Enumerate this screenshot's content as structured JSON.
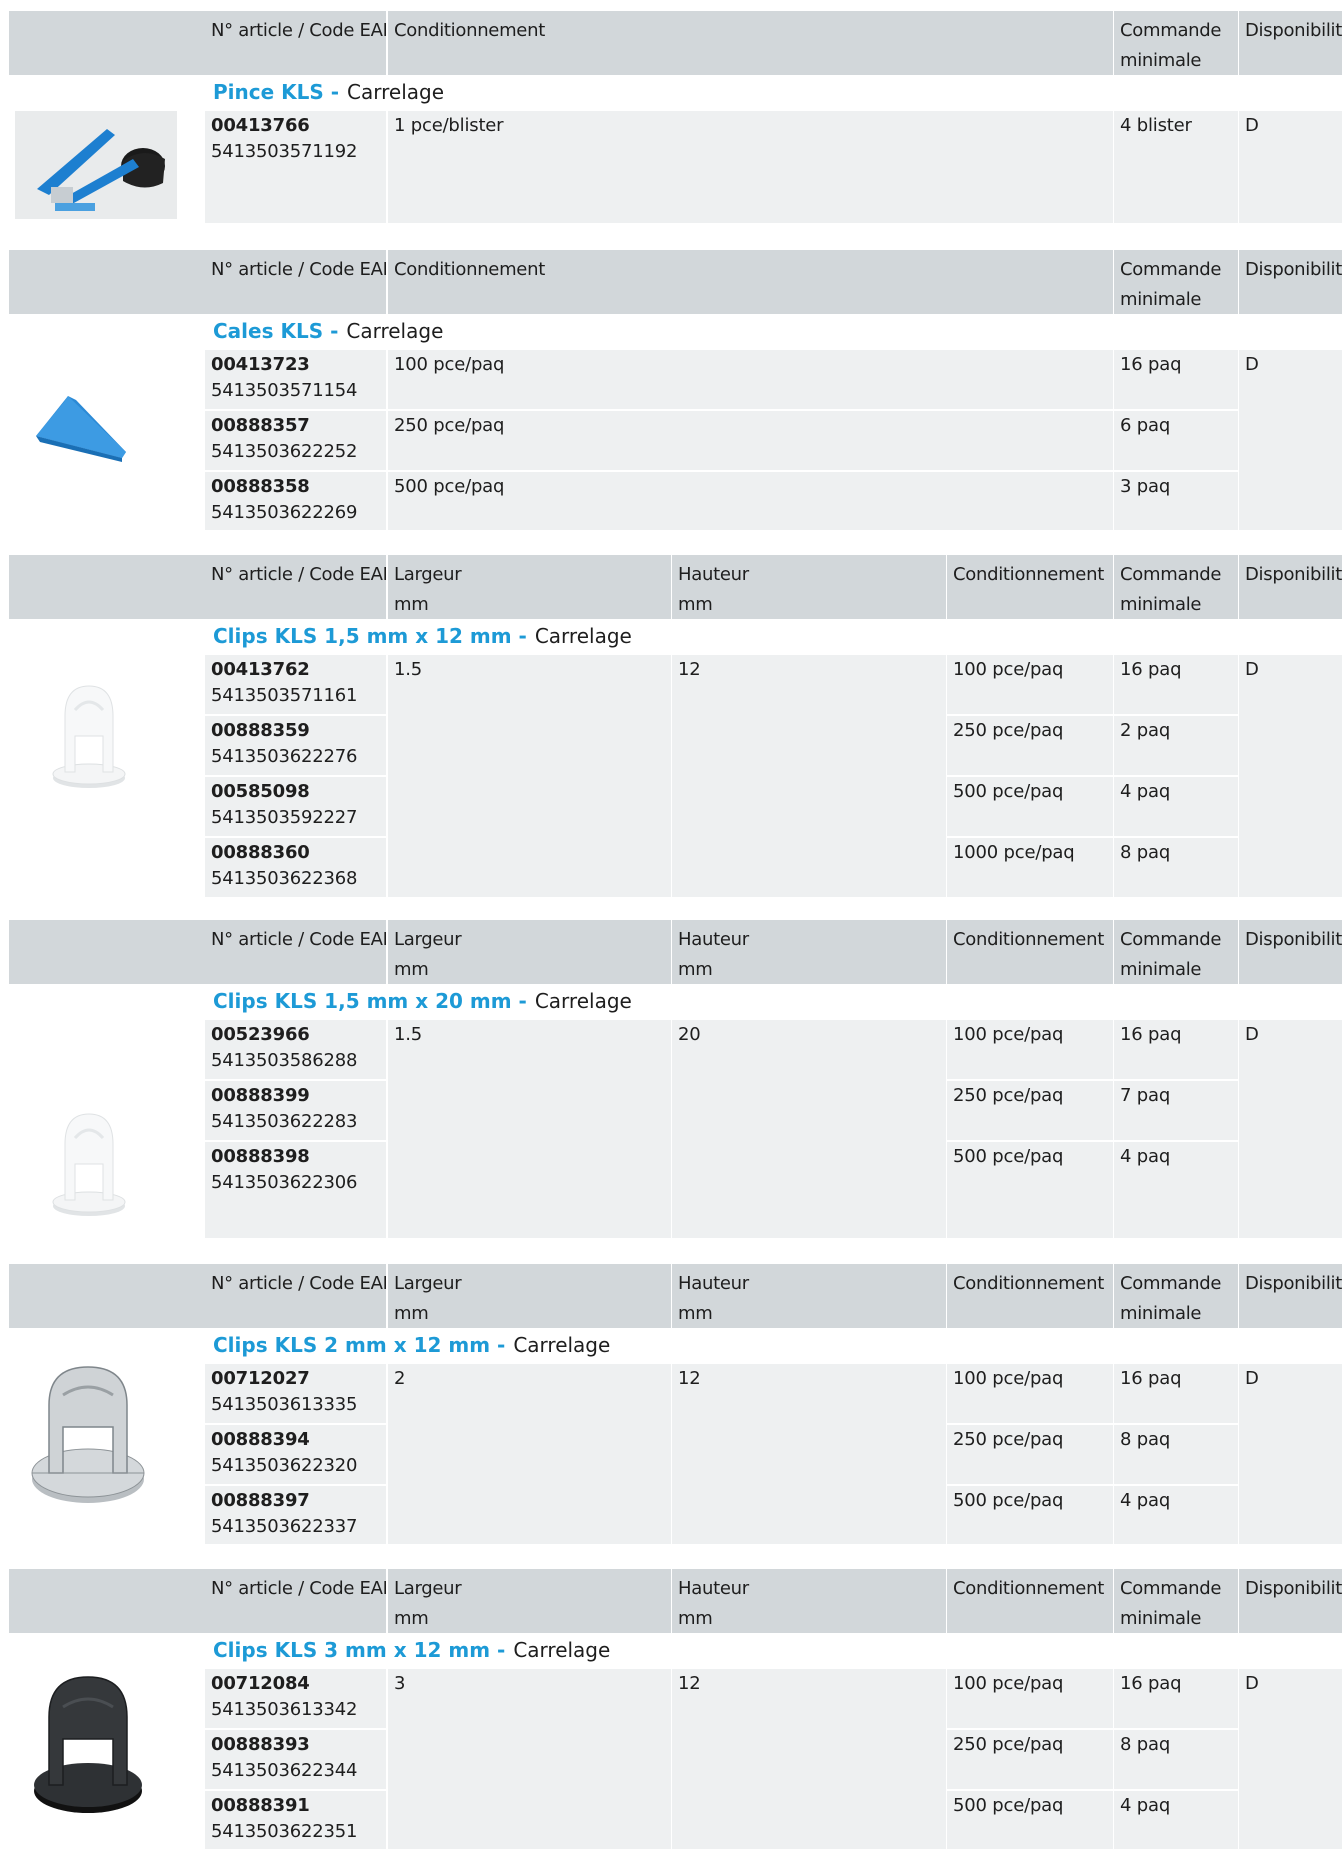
{
  "headers": {
    "simple": [
      "N° article / Code EAN",
      "Conditionnement",
      "Commande\nminimale",
      "Disponibilité"
    ],
    "dims": [
      "N° article / Code EAN",
      "Largeur\nmm",
      "Hauteur\nmm",
      "Conditionnement",
      "Commande\nminimale",
      "Disponibilité"
    ]
  },
  "sections": [
    {
      "title": "Pince KLS -",
      "category": "Carrelage",
      "image_icon": "tile-leveling-pliers-icon",
      "availability": "D",
      "rows": [
        {
          "code": "00413766",
          "ean": "5413503571192",
          "packaging": "1 pce/blister",
          "min_order": "4 blister"
        }
      ]
    },
    {
      "title": "Cales KLS -",
      "category": "Carrelage",
      "image_icon": "blue-wedge-icon",
      "availability": "D",
      "rows": [
        {
          "code": "00413723",
          "ean": "5413503571154",
          "packaging": "100 pce/paq",
          "min_order": "16 paq"
        },
        {
          "code": "00888357",
          "ean": "5413503622252",
          "packaging": "250 pce/paq",
          "min_order": "6 paq"
        },
        {
          "code": "00888358",
          "ean": "5413503622269",
          "packaging": "500 pce/paq",
          "min_order": "3 paq"
        }
      ]
    },
    {
      "title": "Clips KLS 1,5 mm x 12 mm -",
      "category": "Carrelage",
      "image_icon": "white-clip-icon",
      "width": "1.5",
      "height": "12",
      "availability": "D",
      "rows": [
        {
          "code": "00413762",
          "ean": "5413503571161",
          "packaging": "100 pce/paq",
          "min_order": "16 paq"
        },
        {
          "code": "00888359",
          "ean": "5413503622276",
          "packaging": "250 pce/paq",
          "min_order": "2 paq"
        },
        {
          "code": "00585098",
          "ean": "5413503592227",
          "packaging": "500 pce/paq",
          "min_order": "4 paq"
        },
        {
          "code": "00888360",
          "ean": "5413503622368",
          "packaging": "1000 pce/paq",
          "min_order": "8 paq"
        }
      ]
    },
    {
      "title": "Clips KLS 1,5 mm x 20 mm -",
      "category": "Carrelage",
      "image_icon": "white-clip-icon",
      "width": "1.5",
      "height": "20",
      "availability": "D",
      "rows": [
        {
          "code": "00523966",
          "ean": "5413503586288",
          "packaging": "100 pce/paq",
          "min_order": "16 paq"
        },
        {
          "code": "00888399",
          "ean": "5413503622283",
          "packaging": "250 pce/paq",
          "min_order": "7 paq"
        },
        {
          "code": "00888398",
          "ean": "5413503622306",
          "packaging": "500 pce/paq",
          "min_order": "4 paq"
        }
      ]
    },
    {
      "title": "Clips KLS 2 mm x 12 mm -",
      "category": "Carrelage",
      "image_icon": "grey-clip-icon",
      "width": "2",
      "height": "12",
      "availability": "D",
      "rows": [
        {
          "code": "00712027",
          "ean": "5413503613335",
          "packaging": "100 pce/paq",
          "min_order": "16 paq"
        },
        {
          "code": "00888394",
          "ean": "5413503622320",
          "packaging": "250 pce/paq",
          "min_order": "8 paq"
        },
        {
          "code": "00888397",
          "ean": "5413503622337",
          "packaging": "500 pce/paq",
          "min_order": "4 paq"
        }
      ]
    },
    {
      "title": "Clips KLS 3 mm x 12 mm -",
      "category": "Carrelage",
      "image_icon": "black-clip-icon",
      "width": "3",
      "height": "12",
      "availability": "D",
      "rows": [
        {
          "code": "00712084",
          "ean": "5413503613342",
          "packaging": "100 pce/paq",
          "min_order": "16 paq"
        },
        {
          "code": "00888393",
          "ean": "5413503622344",
          "packaging": "250 pce/paq",
          "min_order": "8 paq"
        },
        {
          "code": "00888391",
          "ean": "5413503622351",
          "packaging": "500 pce/paq",
          "min_order": "4 paq"
        }
      ]
    }
  ]
}
